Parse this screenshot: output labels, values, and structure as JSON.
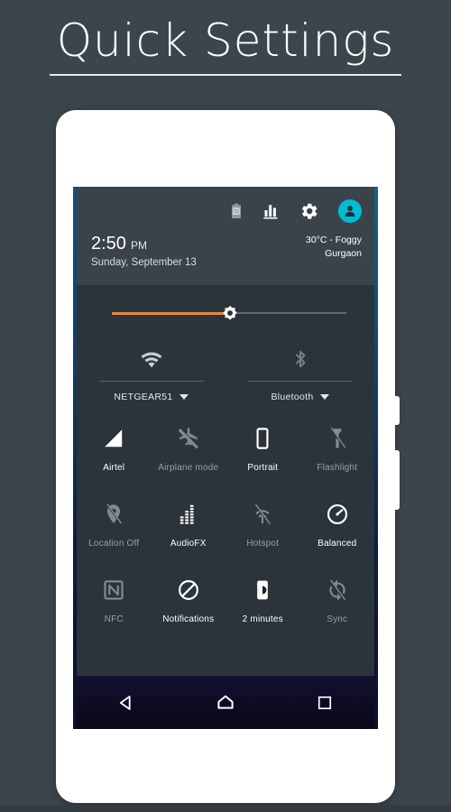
{
  "title": {
    "text": "Quick Settings"
  },
  "status": {
    "icons": [
      {
        "name": "battery-icon",
        "label": "Battery"
      },
      {
        "name": "data-usage-icon",
        "label": "Data usage"
      },
      {
        "name": "settings-gear-icon",
        "label": "Settings"
      },
      {
        "name": "user-avatar-icon",
        "label": "User"
      }
    ],
    "avatar_color": "#00bcd4"
  },
  "clock": {
    "time": "2:50",
    "ampm": "PM",
    "date": "Sunday, September 13"
  },
  "weather": {
    "conditions": "30°C - Foggy",
    "location": "Gurgaon"
  },
  "brightness": {
    "name": "brightness-slider",
    "value_percent": 50,
    "fill_color": "#e8873a",
    "track_color": "#5c6a72"
  },
  "connections": [
    {
      "icon": "wifi-icon",
      "label": "NETGEAR51",
      "state": "on"
    },
    {
      "icon": "bluetooth-off-icon",
      "label": "Bluetooth",
      "state": "off"
    }
  ],
  "tiles": [
    [
      {
        "icon": "signal-cellular-icon",
        "label": "Airtel",
        "state": "on"
      },
      {
        "icon": "airplane-mode-off-icon",
        "label": "Airplane mode",
        "state": "off"
      },
      {
        "icon": "screen-rotation-portrait-icon",
        "label": "Portrait",
        "state": "on"
      },
      {
        "icon": "flashlight-off-icon",
        "label": "Flashlight",
        "state": "off"
      }
    ],
    [
      {
        "icon": "location-off-icon",
        "label": "Location Off",
        "state": "off"
      },
      {
        "icon": "audiofx-equalizer-icon",
        "label": "AudioFX",
        "state": "on"
      },
      {
        "icon": "hotspot-off-icon",
        "label": "Hotspot",
        "state": "off"
      },
      {
        "icon": "performance-balanced-icon",
        "label": "Balanced",
        "state": "on"
      }
    ],
    [
      {
        "icon": "nfc-icon",
        "label": "NFC",
        "state": "off"
      },
      {
        "icon": "notifications-block-icon",
        "label": "Notifications",
        "state": "on"
      },
      {
        "icon": "screen-timeout-icon",
        "label": "2 minutes",
        "state": "on"
      },
      {
        "icon": "sync-off-icon",
        "label": "Sync",
        "state": "off"
      }
    ]
  ],
  "navbar": [
    {
      "icon": "back-icon",
      "label": "Back"
    },
    {
      "icon": "home-icon",
      "label": "Home"
    },
    {
      "icon": "recents-icon",
      "label": "Recents"
    }
  ],
  "colors": {
    "page_background": "#3b454c",
    "panel_header": "#3b434a",
    "panel_body": "#2b343a",
    "accent": "#00bcd4",
    "tile_on": "#ffffff",
    "tile_off": "#93a0a8"
  }
}
